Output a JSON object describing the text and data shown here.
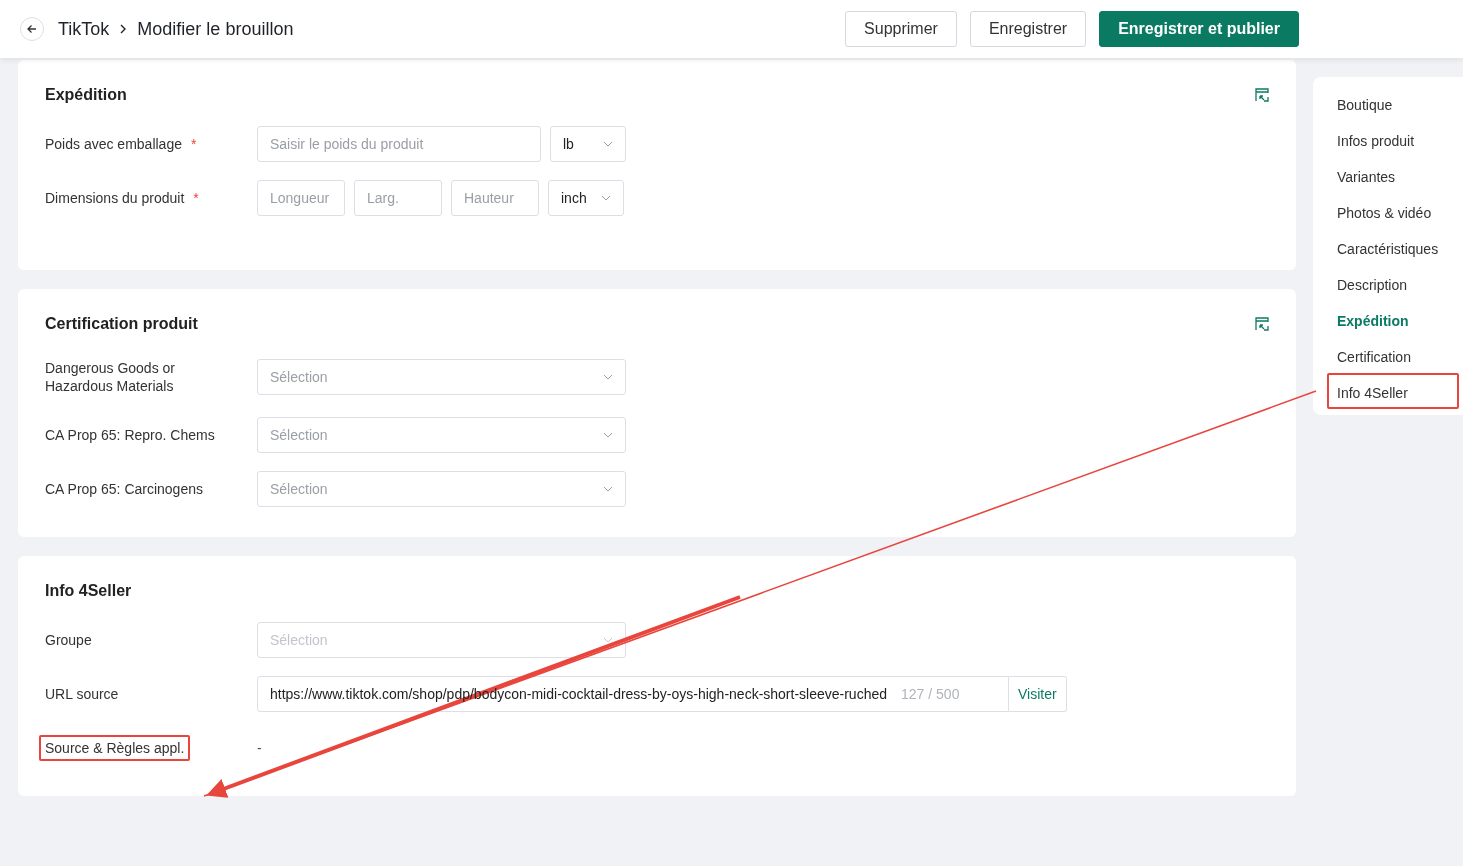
{
  "header": {
    "breadcrumb": [
      "TikTok",
      "Modifier le brouillon"
    ],
    "buttons": [
      {
        "label": "Supprimer",
        "kind": "default"
      },
      {
        "label": "Enregistrer",
        "kind": "default"
      },
      {
        "label": "Enregistrer et publier",
        "kind": "primary"
      }
    ]
  },
  "sections": [
    {
      "title": "Expédition",
      "collapse_icon": true,
      "rows": [
        {
          "label": "Poids avec emballage",
          "required_mark": "*",
          "highlighted": false,
          "controls": [
            {
              "kind": "input",
              "placeholder": "Saisir le poids du produit"
            },
            {
              "kind": "select",
              "value": "lb"
            }
          ]
        },
        {
          "label": "Dimensions du produit",
          "required_mark": "*",
          "highlighted": false,
          "controls": [
            {
              "kind": "input",
              "placeholder": "Longueur"
            },
            {
              "kind": "input",
              "placeholder": "Larg."
            },
            {
              "kind": "input",
              "placeholder": "Hauteur"
            },
            {
              "kind": "select",
              "value": "inch"
            }
          ]
        }
      ]
    },
    {
      "title": "Certification produit",
      "collapse_icon": true,
      "rows": [
        {
          "label": "Dangerous Goods or Hazardous Materials",
          "highlighted": false,
          "controls": [
            {
              "kind": "select",
              "placeholder": "Sélection"
            }
          ]
        },
        {
          "label": "CA Prop 65: Repro. Chems",
          "highlighted": false,
          "controls": [
            {
              "kind": "select",
              "placeholder": "Sélection"
            }
          ]
        },
        {
          "label": "CA Prop 65: Carcinogens",
          "highlighted": false,
          "controls": [
            {
              "kind": "select",
              "placeholder": "Sélection"
            }
          ]
        }
      ]
    },
    {
      "title": "Info 4Seller",
      "collapse_icon": false,
      "rows": [
        {
          "label": "Groupe",
          "highlighted": false,
          "controls": [
            {
              "kind": "select",
              "placeholder": "Sélection",
              "disabled": true
            }
          ]
        },
        {
          "label": "URL source",
          "highlighted": false,
          "controls": [
            {
              "kind": "url",
              "value": "https://www.tiktok.com/shop/pdp/bodycon-midi-cocktail-dress-by-oys-high-neck-short-sleeve-ruched",
              "counter": "127 / 500",
              "action": "Visiter"
            }
          ]
        },
        {
          "label": "Source & Règles appl.",
          "highlighted": true,
          "controls": [
            {
              "kind": "text",
              "value": "-"
            }
          ]
        }
      ]
    }
  ],
  "nav": [
    {
      "label": "Boutique",
      "selected": false,
      "highlighted": false
    },
    {
      "label": "Infos produit",
      "selected": false,
      "highlighted": false
    },
    {
      "label": "Variantes",
      "selected": false,
      "highlighted": false
    },
    {
      "label": "Photos & vidéo",
      "selected": false,
      "highlighted": false
    },
    {
      "label": "Caractéristiques",
      "selected": false,
      "highlighted": false
    },
    {
      "label": "Description",
      "selected": false,
      "highlighted": false
    },
    {
      "label": "Expédition",
      "selected": true,
      "highlighted": false
    },
    {
      "label": "Certification",
      "selected": false,
      "highlighted": false
    },
    {
      "label": "Info 4Seller",
      "selected": false,
      "highlighted": true
    }
  ],
  "annotation_arrow": true
}
